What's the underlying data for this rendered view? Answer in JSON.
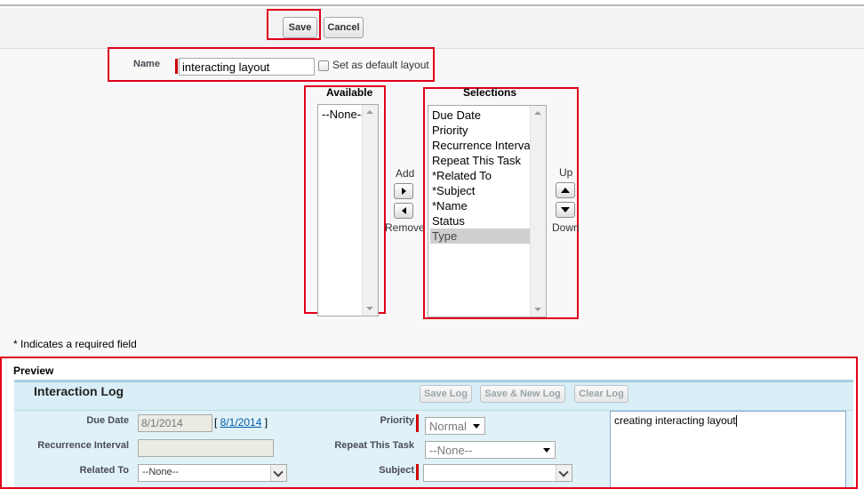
{
  "toolbar": {
    "save_label": "Save",
    "cancel_label": "Cancel"
  },
  "name_field": {
    "label": "Name",
    "value": "interacting layout",
    "default_checkbox_label": "Set as default layout",
    "default_checked": false
  },
  "available": {
    "title": "Available",
    "items": [
      "--None--"
    ]
  },
  "selections": {
    "title": "Selections",
    "items": [
      "Due Date",
      "Priority",
      "Recurrence Interval",
      "Repeat This Task",
      "*Related To",
      "*Subject",
      "*Name",
      "Status",
      "Type"
    ],
    "selected_item": "Type"
  },
  "controls": {
    "add_label": "Add",
    "remove_label": "Remove",
    "up_label": "Up",
    "down_label": "Down"
  },
  "required_note": "* Indicates a required field",
  "preview": {
    "title": "Preview",
    "panel_title": "Interaction Log",
    "buttons": {
      "save_log": "Save Log",
      "save_new_log": "Save & New Log",
      "clear_log": "Clear Log"
    },
    "fields": {
      "due_date_label": "Due Date",
      "due_date_value": "8/1/2014",
      "due_date_link": "8/1/2014",
      "recurrence_label": "Recurrence Interval",
      "related_to_label": "Related To",
      "related_to_value": "--None--",
      "priority_label": "Priority",
      "priority_value": "Normal",
      "repeat_label": "Repeat This Task",
      "repeat_value": "--None--",
      "subject_label": "Subject",
      "subject_value": ""
    },
    "notes_text": "creating interacting layout"
  },
  "colors": {
    "highlight_red": "#e0001b",
    "preview_bg": "#e0f2f8",
    "required_marker": "#cc0000"
  }
}
